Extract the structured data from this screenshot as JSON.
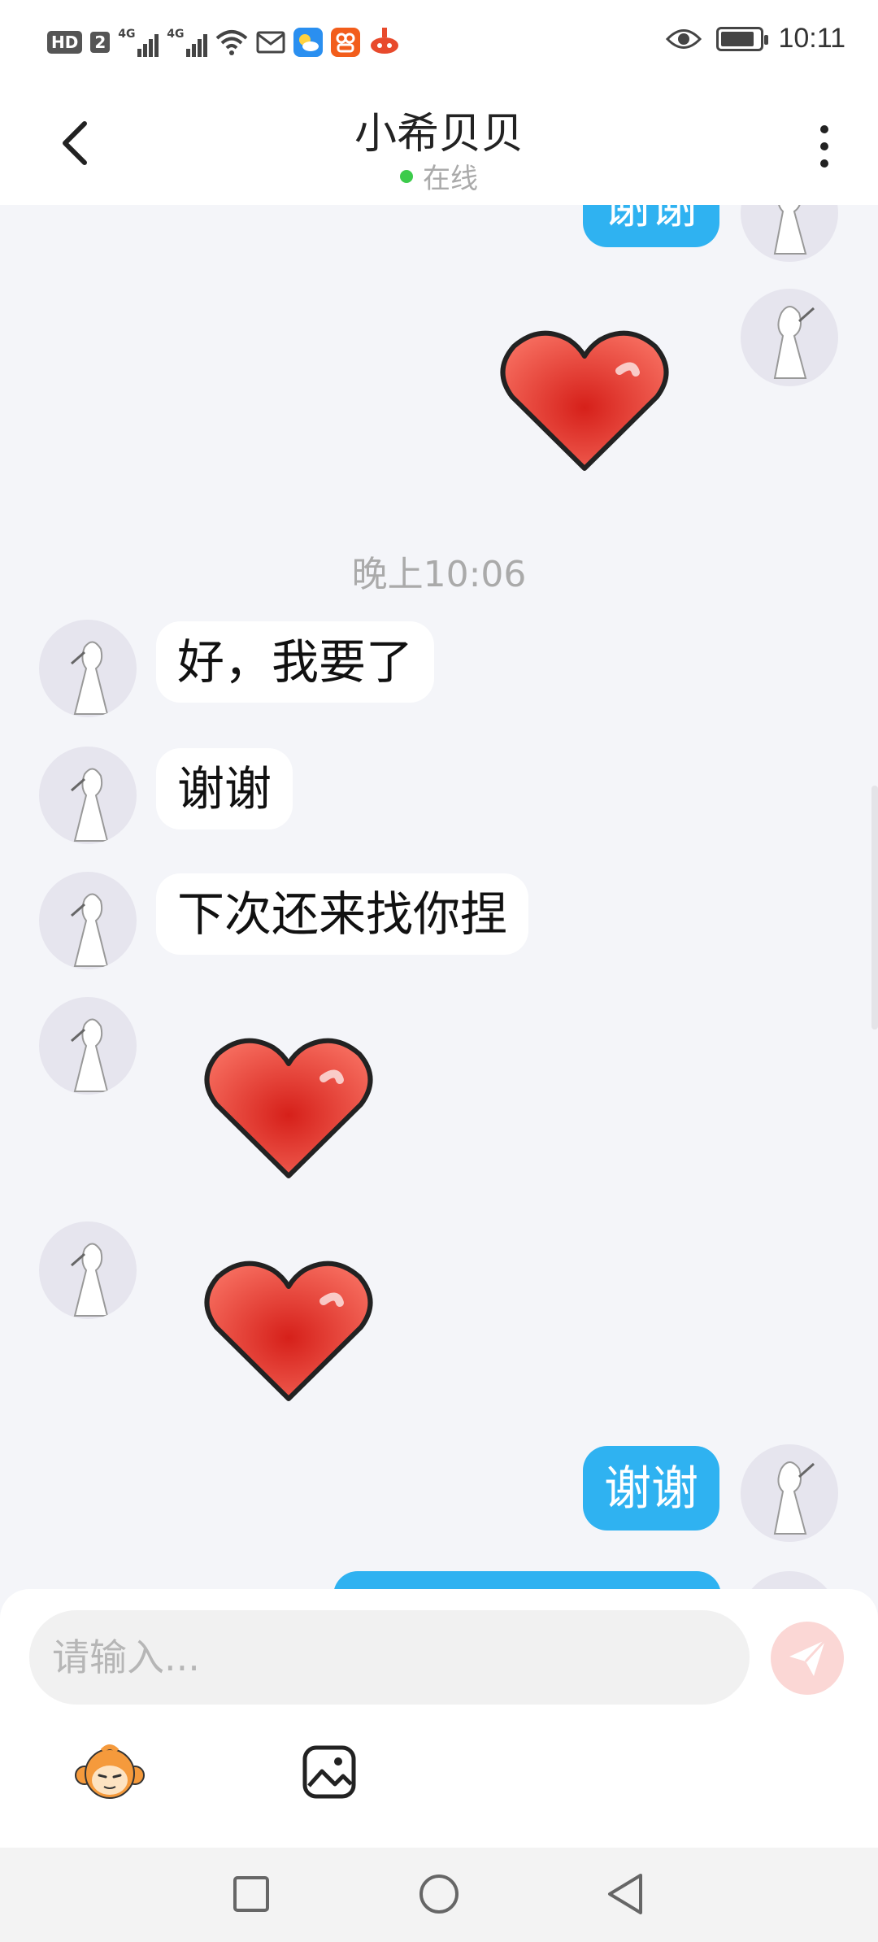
{
  "status_bar": {
    "badge_hd": "HD",
    "sim_number": "2",
    "network_1": "4G",
    "network_2": "4G",
    "time": "10:11",
    "battery_level": 0.85,
    "icons": [
      "wifi-icon",
      "mail-icon",
      "weather-app-icon",
      "game-app-icon",
      "rocket-app-icon",
      "eye-icon",
      "battery-icon"
    ]
  },
  "header": {
    "back_icon": "chevron-left-icon",
    "title": "小希贝贝",
    "status": "在线",
    "status_color": "#3ccb4b",
    "more_icon": "more-vertical-icon"
  },
  "chat": {
    "top_partial_bubble": "谢谢",
    "timestamp": "晚上10:06",
    "incoming": [
      {
        "text": "好，我要了"
      },
      {
        "text": "谢谢"
      },
      {
        "text": "下次还来找你捏"
      }
    ],
    "outgoing_bottom": "谢谢",
    "sticker": "heart-sticker",
    "colors": {
      "outgoing_bubble": "#2fb2f1",
      "incoming_bubble": "#ffffff",
      "background": "#f4f5f9"
    }
  },
  "input": {
    "placeholder": "请输入...",
    "send_icon": "send-icon",
    "emoji_icon": "monkey-emoji-icon",
    "image_icon": "image-icon"
  },
  "nav": {
    "icons": [
      "recent-apps-icon",
      "home-icon",
      "back-icon"
    ]
  }
}
